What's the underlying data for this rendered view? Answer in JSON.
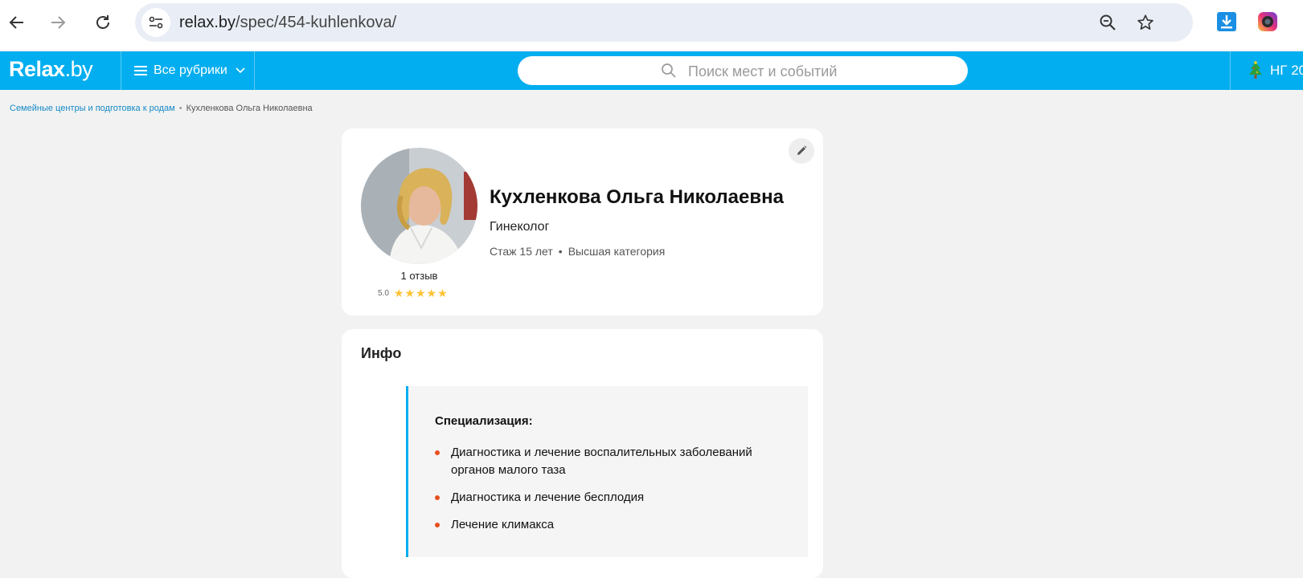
{
  "browser": {
    "url_domain": "relax.by",
    "url_path": "/spec/454-kuhlenkova/",
    "icons": [
      "back-icon",
      "forward-icon",
      "reload-icon",
      "site-settings-icon",
      "zoom-icon",
      "bookmark-star-icon",
      "download-extension-icon",
      "camera-extension-icon"
    ]
  },
  "header": {
    "logo_main": "Relax",
    "logo_domain": ".by",
    "rubrics_label": "Все рубрики",
    "search_placeholder": "Поиск мест и событий",
    "promo_label": "НГ 20",
    "accent_color": "#02aeef"
  },
  "breadcrumb": {
    "parent": "Семейные центры и подготовка к родам",
    "separator": "•",
    "current": "Кухленкова Ольга Николаевна"
  },
  "profile": {
    "name": "Кухленкова Ольга Николаевна",
    "profession": "Гинеколог",
    "experience": "Стаж 15 лет",
    "meta_separator": "•",
    "category": "Высшая категория",
    "reviews": "1 отзыв",
    "rating": "5.0",
    "stars": "★★★★★",
    "star_color": "#ffc233"
  },
  "info": {
    "title": "Инфо",
    "specialization_label": "Специализация:",
    "items": [
      "Диагностика и лечение воспалительных заболеваний органов малого таза",
      "Диагностика и лечение бесплодия",
      "Лечение климакса"
    ],
    "bullet_color": "#e8501e"
  }
}
